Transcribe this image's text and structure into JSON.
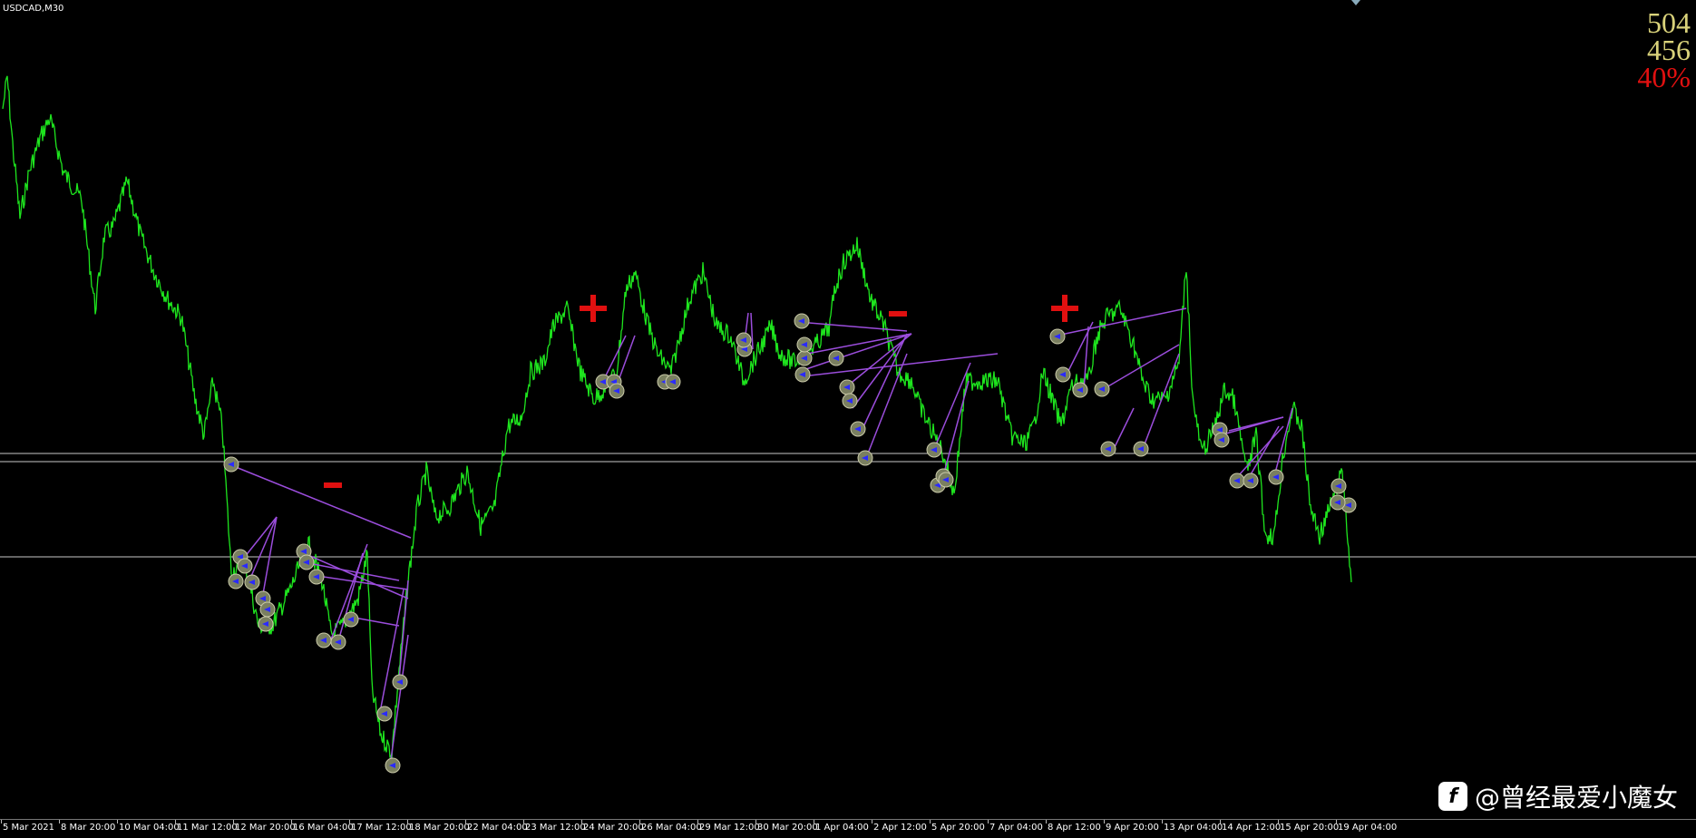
{
  "chart": {
    "symbol": "USDCAD,M30",
    "stats": [
      "504",
      "456",
      "40%"
    ],
    "colors": {
      "price": "#1ee51e",
      "trade_line": "#9b4ddc",
      "hline": "#c8c8c8",
      "sign": "#e01010",
      "background": "#000000"
    },
    "signs": [
      "-",
      "+",
      "-",
      "+"
    ]
  },
  "xaxis": {
    "labels": [
      "5 Mar 2021",
      "8 Mar 20:00",
      "10 Mar 04:00",
      "11 Mar 12:00",
      "12 Mar 20:00",
      "16 Mar 04:00",
      "17 Mar 12:00",
      "18 Mar 20:00",
      "22 Mar 04:00",
      "23 Mar 12:00",
      "24 Mar 20:00",
      "26 Mar 04:00",
      "29 Mar 12:00",
      "30 Mar 20:00",
      "1 Apr 04:00",
      "2 Apr 12:00",
      "5 Apr 20:00",
      "7 Apr 04:00",
      "8 Apr 12:00",
      "9 Apr 20:00",
      "13 Apr 04:00",
      "14 Apr 12:00",
      "15 Apr 20:00",
      "19 Apr 04:00"
    ]
  },
  "watermark": {
    "text": "@曾经最爱小魔女",
    "logo_glyph": "f"
  }
}
